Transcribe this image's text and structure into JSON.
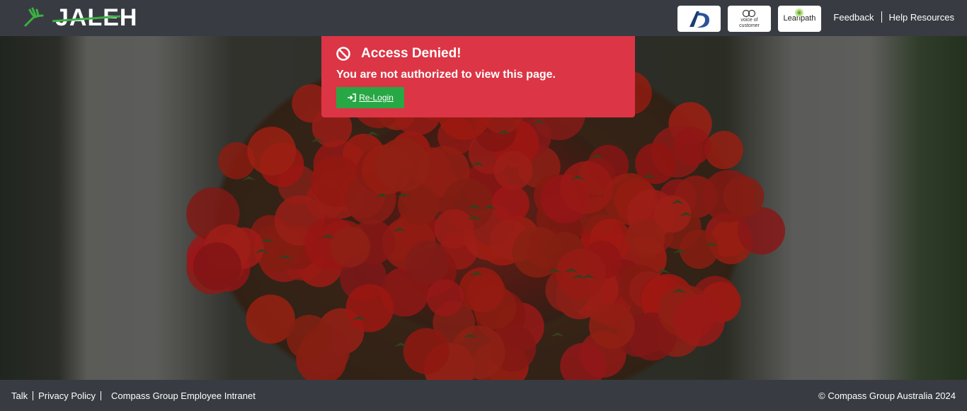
{
  "header": {
    "brand": "JALEH",
    "partner_logos": {
      "ad_mark": "AD",
      "voc_line1": "voice of",
      "voc_line2": "customer",
      "leanpath": "Leanpath"
    },
    "links": [
      "Feedback",
      "Help Resources"
    ]
  },
  "alert": {
    "title": "Access Denied!",
    "message": "You are not authorized to view this page.",
    "button": "Re-Login",
    "color": "#dc3545",
    "button_color": "#28a745",
    "icon": "ban-icon",
    "button_icon": "sign-in-icon"
  },
  "footer": {
    "links": [
      "Talk",
      "Privacy Policy",
      "Compass Group Employee Intranet"
    ],
    "copyright": "© Compass Group Australia 2024"
  },
  "colors": {
    "bar": "#383c42",
    "brand_accent": "#3cb043"
  }
}
